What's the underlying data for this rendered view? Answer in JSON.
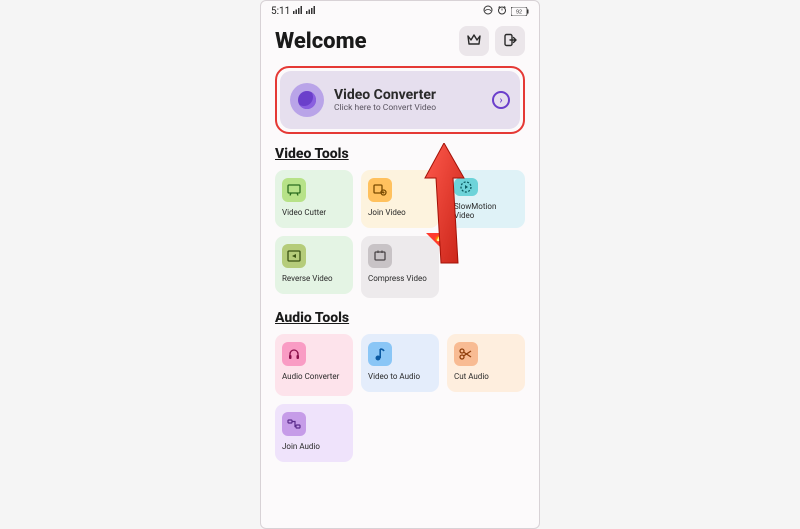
{
  "status": {
    "time": "5:11",
    "battery": "92"
  },
  "header": {
    "title": "Welcome"
  },
  "hero": {
    "title": "Video Converter",
    "subtitle": "Click here to Convert Video"
  },
  "video_section": {
    "title": "Video Tools",
    "tiles": [
      {
        "label": "Video Cutter"
      },
      {
        "label": "Join Video"
      },
      {
        "label": "SlowMotion Video"
      },
      {
        "label": "Reverse Video"
      },
      {
        "label": "Compress Video"
      }
    ]
  },
  "audio_section": {
    "title": "Audio Tools",
    "tiles": [
      {
        "label": "Audio Converter"
      },
      {
        "label": "Video to Audio"
      },
      {
        "label": "Cut Audio"
      },
      {
        "label": "Join Audio"
      }
    ]
  }
}
